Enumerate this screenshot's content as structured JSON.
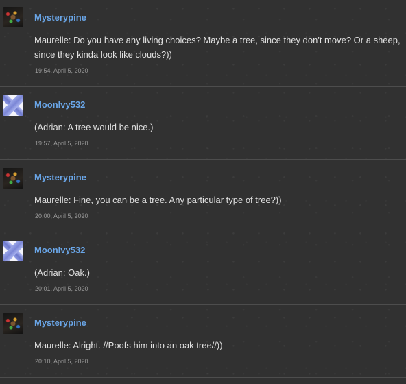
{
  "posts": [
    {
      "username": "Mysterypine",
      "avatar": "mysterypine-avatar",
      "message": "Maurelle: Do you have any living choices? Maybe a tree, since they don't move? Or a sheep, since they kinda look like clouds?))",
      "time": "19:54, April 5, 2020"
    },
    {
      "username": "MoonIvy532",
      "avatar": "moonivy532-avatar",
      "message": "(Adrian: A tree would be nice.)",
      "time": "19:57, April 5, 2020"
    },
    {
      "username": "Mysterypine",
      "avatar": "mysterypine-avatar",
      "message": "Maurelle: Fine, you can be a tree. Any particular type of tree?))",
      "time": "20:00, April 5, 2020"
    },
    {
      "username": "MoonIvy532",
      "avatar": "moonivy532-avatar",
      "message": "(Adrian: Oak.)",
      "time": "20:01, April 5, 2020"
    },
    {
      "username": "Mysterypine",
      "avatar": "mysterypine-avatar",
      "message": "Maurelle: Alright. //Poofs him into an oak tree//))",
      "time": "20:10, April 5, 2020"
    }
  ]
}
